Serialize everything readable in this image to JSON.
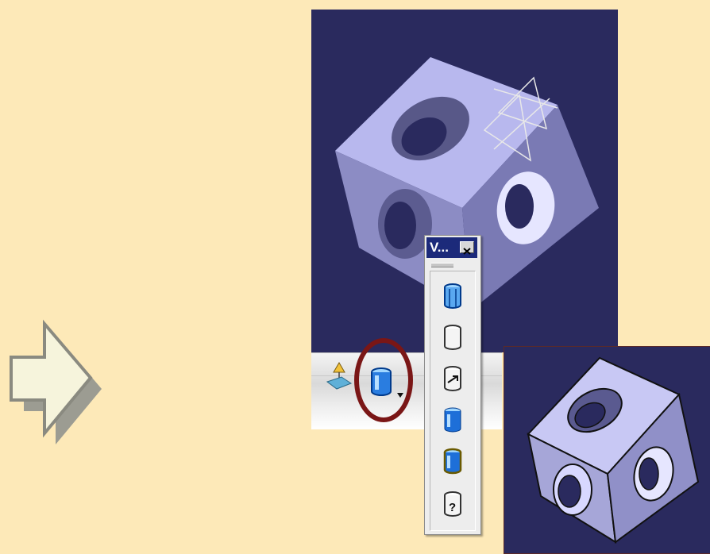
{
  "palette": {
    "title": "V...",
    "items": [
      {
        "name": "iso-wireframe-icon"
      },
      {
        "name": "edges-only-icon"
      },
      {
        "name": "hidden-edges-icon"
      },
      {
        "name": "shading-icon"
      },
      {
        "name": "shading-with-edges-icon"
      },
      {
        "name": "customize-view-icon",
        "label": "?"
      }
    ]
  },
  "toolbar": {
    "items": [
      {
        "name": "compass-icon"
      },
      {
        "name": "view-mode-dropdown-icon"
      }
    ]
  },
  "colors": {
    "background": "#fde9b8",
    "viewport": "#2a2a5e",
    "highlight": "#7a1616",
    "palette_title": "#1c2a7a"
  }
}
